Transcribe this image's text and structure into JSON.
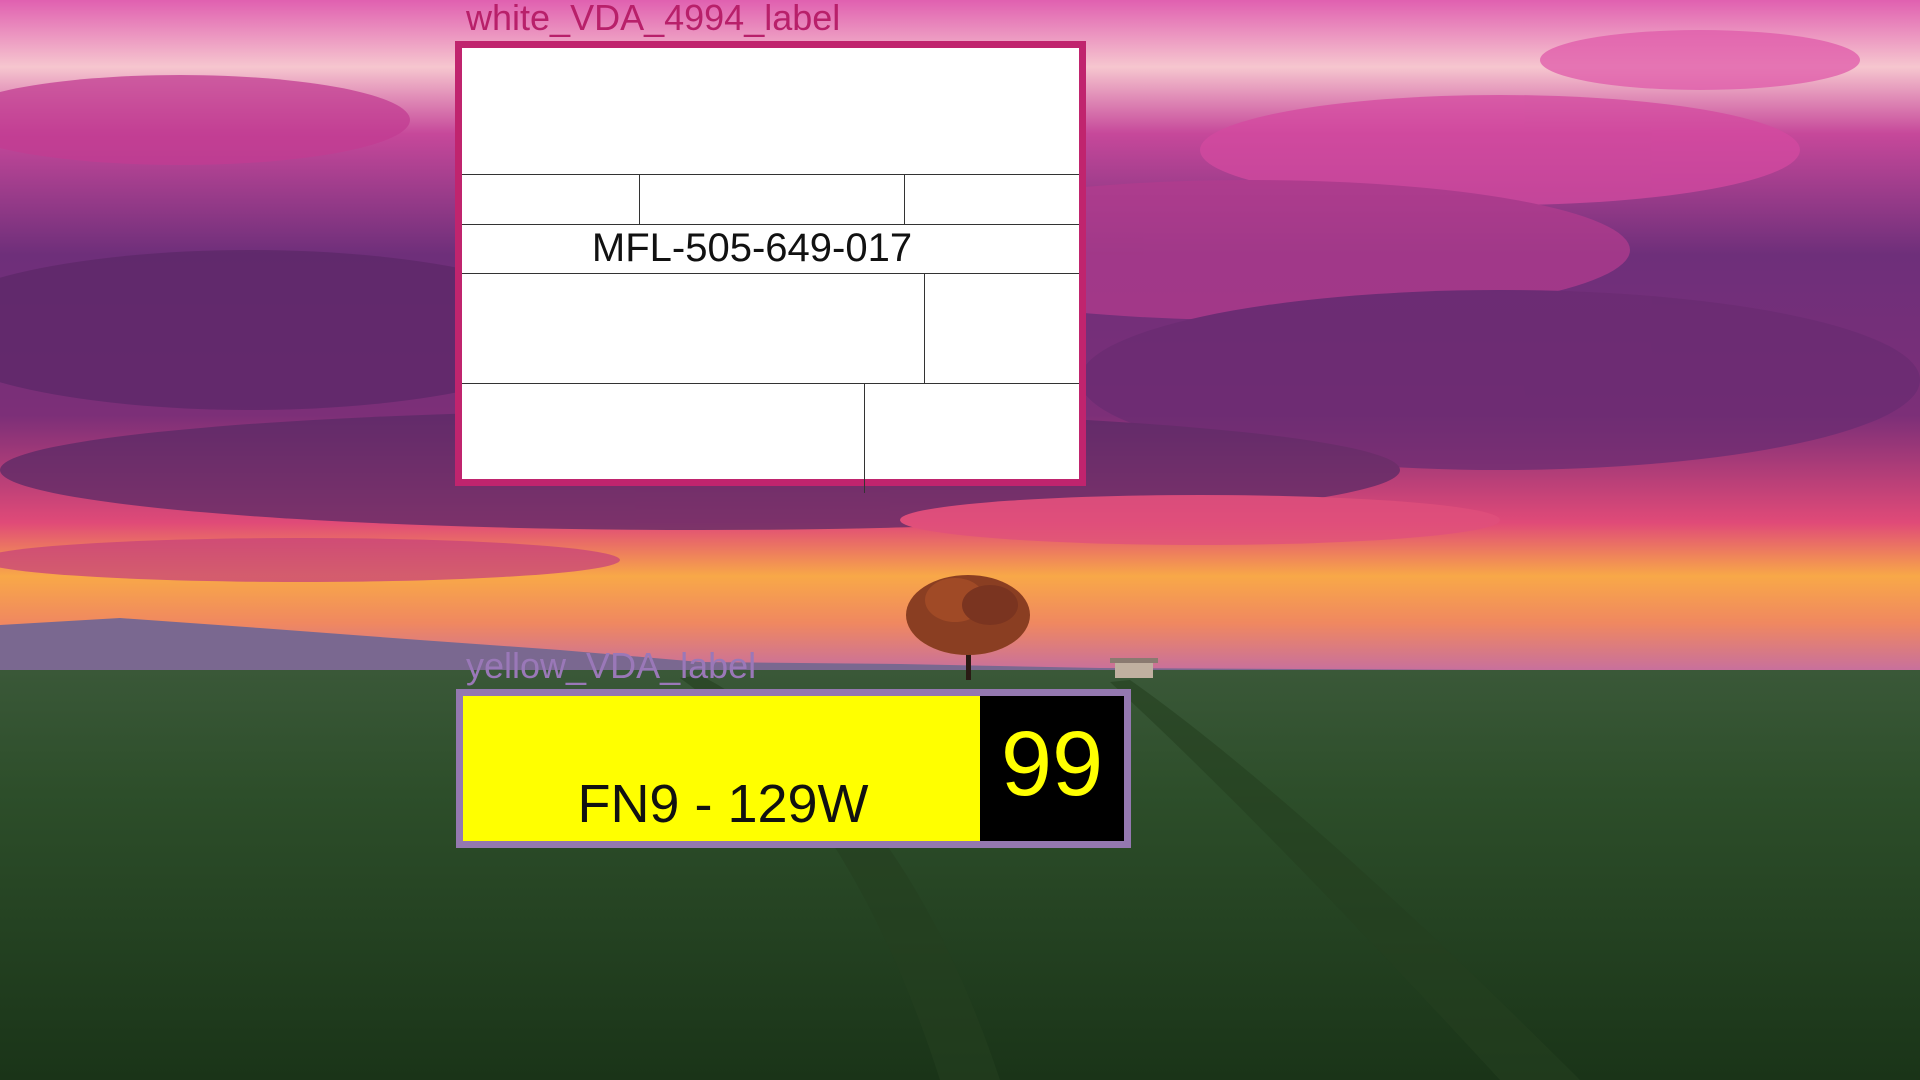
{
  "desktop": {
    "wallpaper": "sunset-over-wheat-field-with-lone-tree",
    "colors": {
      "sky_magenta": "#c84b9c",
      "sky_purple": "#5a2b6a",
      "horizon_orange": "#f8a040",
      "field_green": "#2c4a28"
    }
  },
  "white_label": {
    "caption": "white_VDA_4994_label",
    "code": "MFL-505-649-017",
    "border_color": "#c0246e"
  },
  "yellow_label": {
    "caption": "yellow_VDA_label",
    "code": "FN9 - 129W",
    "number": "99",
    "background_color": "#ffff00",
    "border_color": "#9478b0"
  }
}
